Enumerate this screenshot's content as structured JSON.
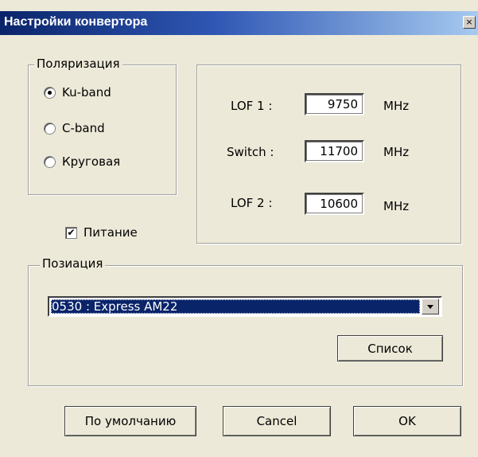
{
  "window": {
    "title": "Настройки конвертора",
    "close_glyph": "×"
  },
  "polarization": {
    "label": "Поляризация",
    "options": [
      "Ku-band",
      "C-band",
      "Круговая"
    ],
    "selected_index": 0
  },
  "lof": {
    "lof1_label": "LOF 1 :",
    "lof1_value": "9750",
    "switch_label": "Switch :",
    "switch_value": "11700",
    "lof2_label": "LOF 2 :",
    "lof2_value": "10600",
    "unit": "MHz"
  },
  "power": {
    "label": "Питание",
    "checked": true,
    "check_glyph": "✔"
  },
  "position": {
    "label": "Позиация",
    "selected": "0530 : Express AM22",
    "list_button": "Список"
  },
  "footer": {
    "default_button": "По умолчанию",
    "cancel_button": "Cancel",
    "ok_button": "OK"
  }
}
